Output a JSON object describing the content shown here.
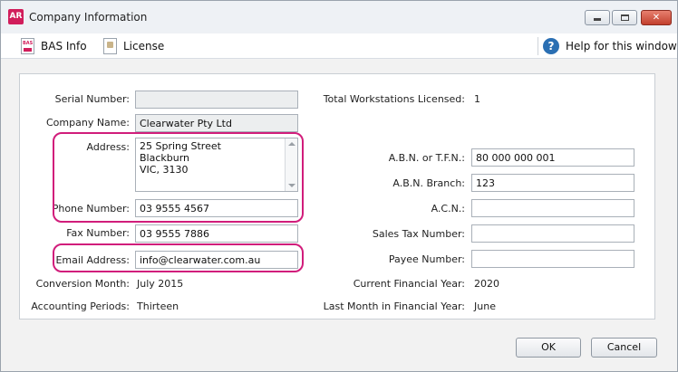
{
  "window": {
    "app_icon": "AR",
    "title": "Company Information",
    "buttons": [
      "minimize-icon",
      "maximize-icon",
      "close-icon"
    ],
    "close_color": "#c2402e"
  },
  "toolbar": {
    "bas_info": "BAS Info",
    "license": "License",
    "help": "Help for this window",
    "help_icon": "?"
  },
  "left_fields": {
    "serial_number": {
      "label": "Serial Number:",
      "value": ""
    },
    "company_name": {
      "label": "Company Name:",
      "value": "Clearwater Pty Ltd"
    },
    "address": {
      "label": "Address:",
      "lines": [
        "25 Spring Street",
        "Blackburn",
        "VIC, 3130"
      ]
    },
    "phone_number": {
      "label": "Phone Number:",
      "value": "03 9555 4567"
    },
    "fax_number": {
      "label": "Fax Number:",
      "value": "03 9555 7886"
    },
    "email_address": {
      "label": "Email Address:",
      "value": "info@clearwater.com.au"
    },
    "conversion_month": {
      "label": "Conversion Month:",
      "value": "July 2015"
    },
    "accounting_periods": {
      "label": "Accounting Periods:",
      "value": "Thirteen"
    }
  },
  "right_fields": {
    "total_workstations": {
      "label": "Total Workstations Licensed:",
      "value": "1"
    },
    "abn": {
      "label": "A.B.N. or T.F.N.:",
      "value": "80 000 000 001"
    },
    "abn_branch": {
      "label": "A.B.N. Branch:",
      "value": "123"
    },
    "acn": {
      "label": "A.C.N.:",
      "value": ""
    },
    "sales_tax_number": {
      "label": "Sales Tax Number:",
      "value": ""
    },
    "payee_number": {
      "label": "Payee Number:",
      "value": ""
    },
    "current_financial_year": {
      "label": "Current Financial Year:",
      "value": "2020"
    },
    "last_month_financial_year": {
      "label": "Last Month in Financial Year:",
      "value": "June"
    }
  },
  "buttons": {
    "ok": "OK",
    "cancel": "Cancel"
  },
  "highlight_color": "#d11d7b"
}
